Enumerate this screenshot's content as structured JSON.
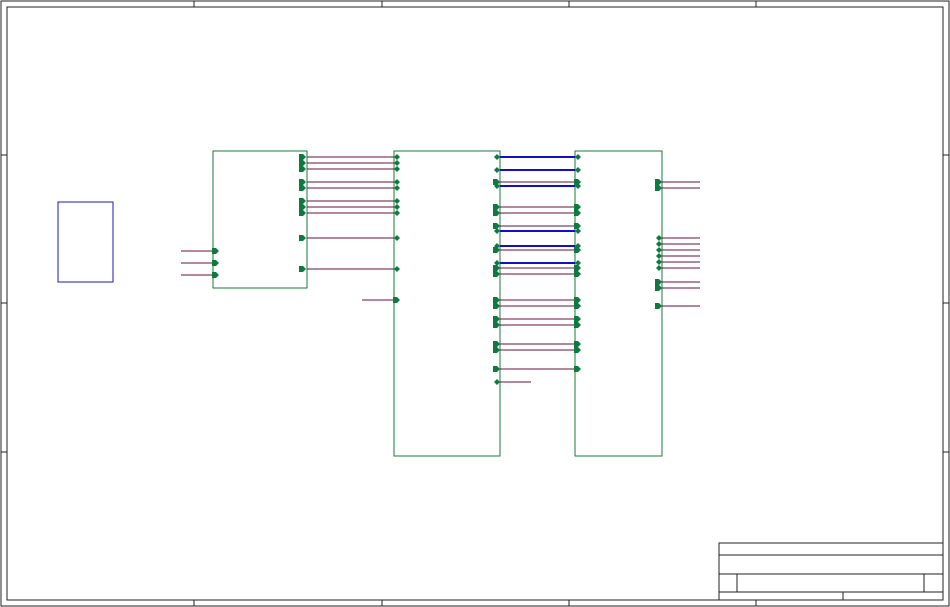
{
  "colors": {
    "frame": "#222222",
    "sheet_symbol": "#1a7a3a",
    "port_fill": "#0f7a3f",
    "wire": "#6b0f3a",
    "bus": "#1010c8",
    "note_box": "#1a1abf"
  },
  "sheet": {
    "column_zones": 5,
    "row_zones": 4
  },
  "blocks": [
    {
      "id": "sheet-symbol-1",
      "label": ""
    },
    {
      "id": "sheet-symbol-2",
      "label": ""
    },
    {
      "id": "sheet-symbol-3",
      "label": ""
    },
    {
      "id": "sheet-symbol-4",
      "label": ""
    }
  ],
  "connections": {
    "block1_inputs": 3,
    "block1_to_block2_wires": 8,
    "block2_to_block3_buses": 6,
    "block2_to_block3_wires": 13,
    "block3_outputs": 10
  },
  "title_block": {
    "title": "",
    "sheet_number": "",
    "revision": ""
  }
}
